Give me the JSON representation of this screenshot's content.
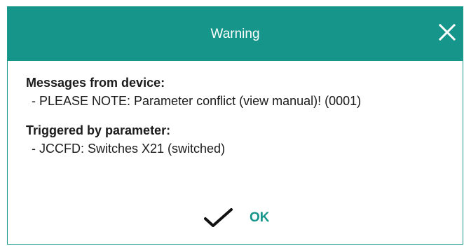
{
  "dialog": {
    "title": "Warning",
    "close_icon": "close-icon",
    "sections": [
      {
        "heading": "Messages from device:",
        "lines": [
          "- PLEASE NOTE: Parameter conflict (view manual)! (0001)"
        ]
      },
      {
        "heading": "Triggered by parameter:",
        "lines": [
          "- JCCFD: Switches X21 (switched)"
        ]
      }
    ],
    "ok_button": {
      "label": "OK",
      "icon": "checkmark-icon"
    }
  },
  "colors": {
    "titlebar": "#16958a",
    "accent": "#16958a",
    "text": "#1b1b1b"
  }
}
